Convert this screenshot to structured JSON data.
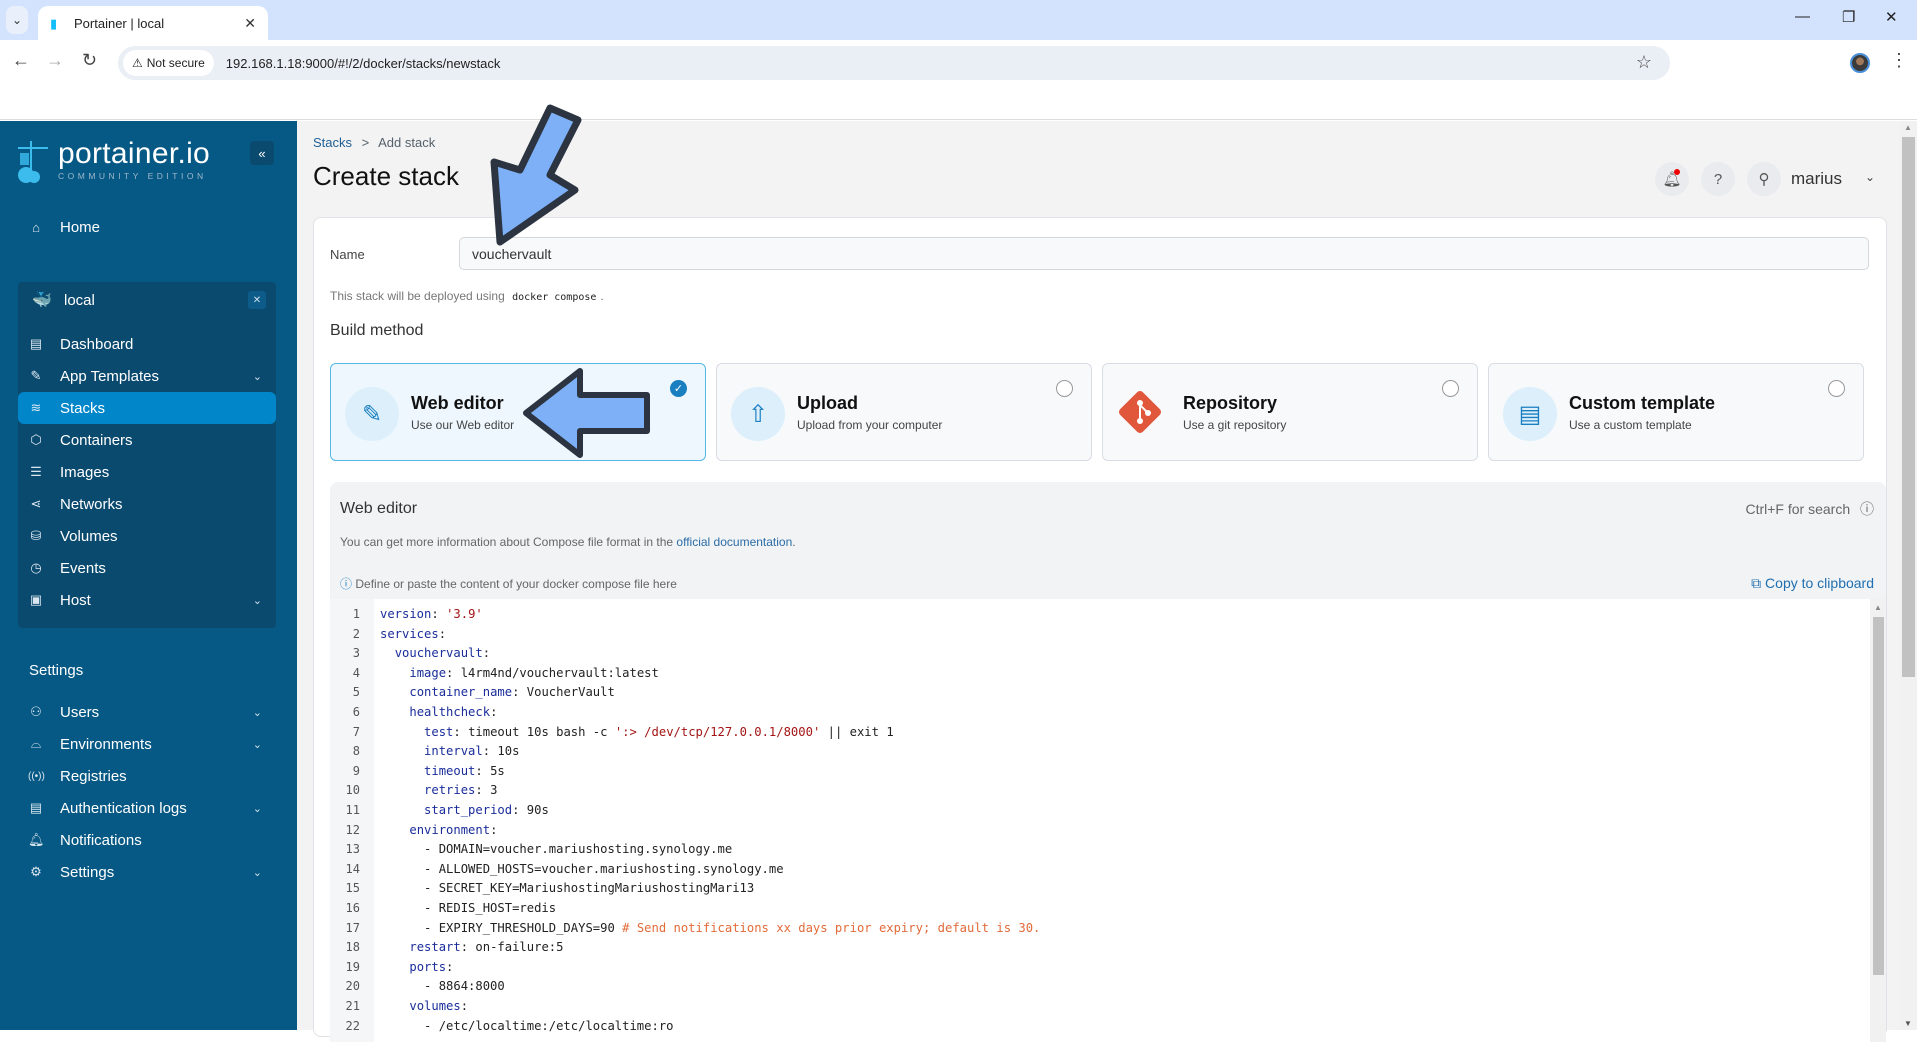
{
  "browser": {
    "tab_title": "Portainer | local",
    "security_label": "Not secure",
    "url": "192.168.1.18:9000/#!/2/docker/stacks/newstack"
  },
  "sidebar": {
    "logo_brand": "portainer.io",
    "logo_edition": "COMMUNITY EDITION",
    "home_label": "Home",
    "environment": {
      "name": "local",
      "items": [
        {
          "label": "Dashboard",
          "icon": "dashboard-icon",
          "expandable": false
        },
        {
          "label": "App Templates",
          "icon": "edit-icon",
          "expandable": true
        },
        {
          "label": "Stacks",
          "icon": "layers-icon",
          "expandable": false,
          "active": true
        },
        {
          "label": "Containers",
          "icon": "box-icon",
          "expandable": false
        },
        {
          "label": "Images",
          "icon": "list-icon",
          "expandable": false
        },
        {
          "label": "Networks",
          "icon": "share-icon",
          "expandable": false
        },
        {
          "label": "Volumes",
          "icon": "database-icon",
          "expandable": false
        },
        {
          "label": "Events",
          "icon": "clock-icon",
          "expandable": false
        },
        {
          "label": "Host",
          "icon": "server-icon",
          "expandable": true
        }
      ]
    },
    "settings_heading": "Settings",
    "settings_items": [
      {
        "label": "Users",
        "icon": "users-icon",
        "expandable": true
      },
      {
        "label": "Environments",
        "icon": "hard-drive-icon",
        "expandable": true
      },
      {
        "label": "Registries",
        "icon": "radio-icon",
        "expandable": false
      },
      {
        "label": "Authentication logs",
        "icon": "file-text-icon",
        "expandable": true
      },
      {
        "label": "Notifications",
        "icon": "bell-icon",
        "expandable": false
      },
      {
        "label": "Settings",
        "icon": "gear-icon",
        "expandable": true
      }
    ]
  },
  "header": {
    "breadcrumb_parent": "Stacks",
    "breadcrumb_sep": ">",
    "breadcrumb_current": "Add stack",
    "title": "Create stack",
    "username": "marius"
  },
  "form": {
    "name_label": "Name",
    "name_value": "vouchervault",
    "deploy_hint_prefix": "This stack will be deployed using",
    "deploy_hint_code": "docker compose",
    "deploy_hint_suffix": ".",
    "build_method_title": "Build method",
    "build_methods": [
      {
        "title": "Web editor",
        "desc": "Use our Web editor",
        "selected": true
      },
      {
        "title": "Upload",
        "desc": "Upload from your computer",
        "selected": false
      },
      {
        "title": "Repository",
        "desc": "Use a git repository",
        "selected": false
      },
      {
        "title": "Custom template",
        "desc": "Use a custom template",
        "selected": false
      }
    ]
  },
  "web_editor": {
    "title": "Web editor",
    "search_hint": "Ctrl+F for search",
    "info_prefix": "You can get more information about Compose file format in the",
    "info_link": "official documentation",
    "info_suffix": ".",
    "define_hint": "Define or paste the content of your docker compose file here",
    "copy_label": "Copy to clipboard",
    "lines": [
      "version: '3.9'",
      "services:",
      "  vouchervault:",
      "    image: l4rm4nd/vouchervault:latest",
      "    container_name: VoucherVault",
      "    healthcheck:",
      "      test: timeout 10s bash -c ':> /dev/tcp/127.0.0.1/8000' || exit 1",
      "      interval: 10s",
      "      timeout: 5s",
      "      retries: 3",
      "      start_period: 90s",
      "    environment:",
      "      - DOMAIN=voucher.mariushosting.synology.me",
      "      - ALLOWED_HOSTS=voucher.mariushosting.synology.me",
      "      - SECRET_KEY=MariushostingMariushostingMari13",
      "      - REDIS_HOST=redis",
      "      - EXPIRY_THRESHOLD_DAYS=90 # Send notifications xx days prior expiry; default is 30.",
      "    restart: on-failure:5",
      "    ports:",
      "      - 8864:8000",
      "    volumes:",
      "      - /etc/localtime:/etc/localtime:ro"
    ]
  }
}
